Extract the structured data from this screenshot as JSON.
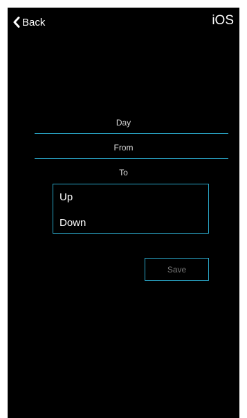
{
  "platform_label": "iOS",
  "nav": {
    "back_label": "Back",
    "back_icon": "chevron-left-icon"
  },
  "form": {
    "day_label": "Day",
    "from_label": "From",
    "to_label": "To"
  },
  "direction_dropdown": {
    "options": [
      "Up",
      "Down"
    ]
  },
  "actions": {
    "save_label": "Save"
  },
  "colors": {
    "background": "#000000",
    "accent": "#2aa7c9",
    "text": "#ffffff",
    "muted_text": "#7a7a7a"
  }
}
